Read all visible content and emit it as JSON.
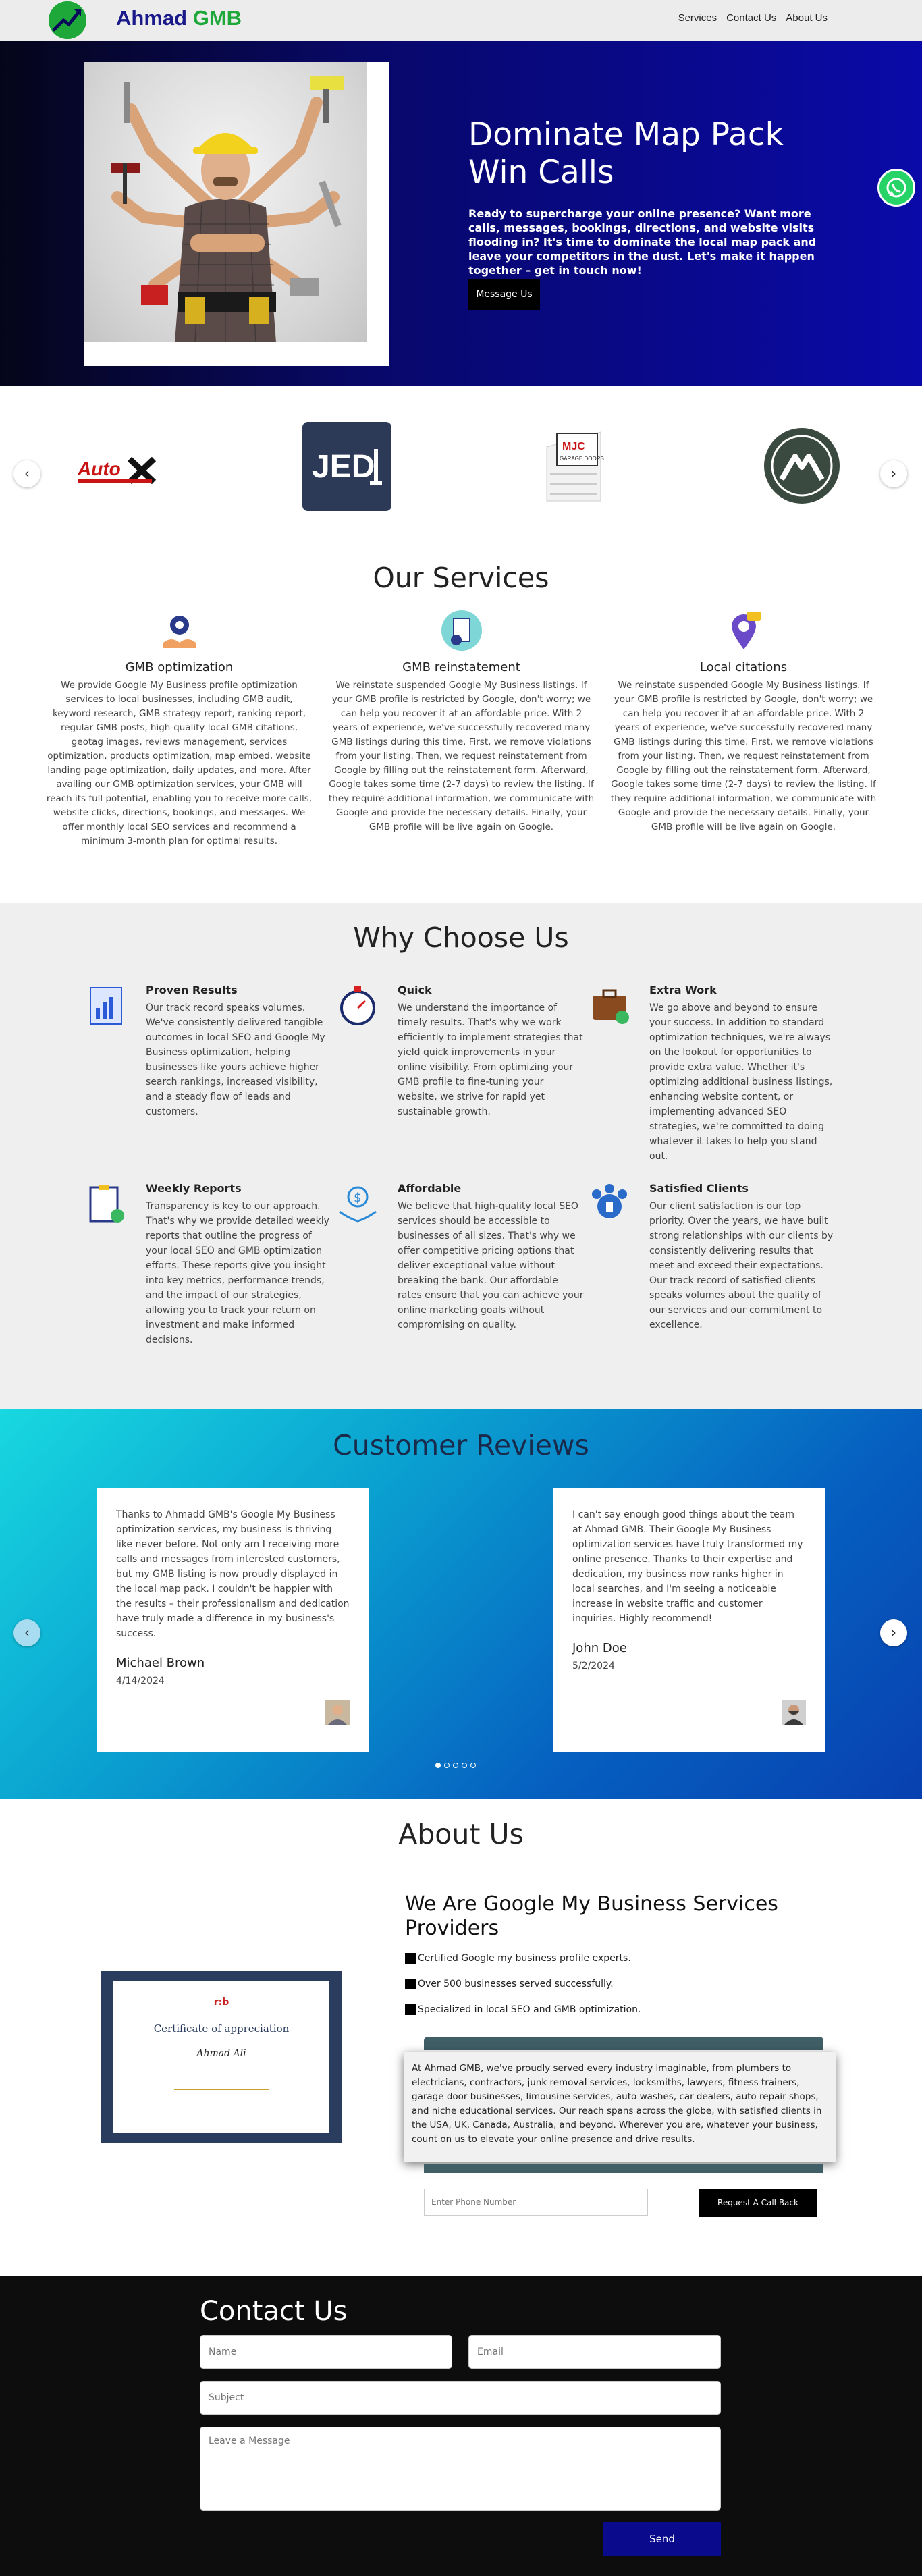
{
  "nav": {
    "brand_part1": "Ahmad",
    "brand_part2": "GMB",
    "links": [
      "Services",
      "Contact Us",
      "About Us"
    ]
  },
  "hero": {
    "title_line1": "Dominate Map Pack",
    "title_line2": "Win Calls",
    "text": "Ready to supercharge your online presence? Want more calls, messages, bookings, directions, and website visits flooding in? It's time to dominate the local map pack and leave your competitors in the dust. Let's make it happen together – get in touch now!",
    "button": "Message Us"
  },
  "logos": {
    "items": [
      "AutoX",
      "JED",
      "MJC Garage Doors",
      "Mountain logo"
    ]
  },
  "services": {
    "title": "Our Services",
    "items": [
      {
        "title": "GMB optimization",
        "text": "We provide Google My Business profile optimization services to local businesses, including GMB audit, keyword research, GMB strategy report, ranking report, regular GMB posts, high-quality local GMB citations, geotag images, reviews management, services optimization, products optimization, map embed, website landing page optimization, daily updates, and more. After availing our GMB optimization services, your GMB will reach its full potential, enabling you to receive more calls, website clicks, directions, bookings, and messages. We offer monthly local SEO services and recommend a minimum 3-month plan for optimal results."
      },
      {
        "title": "GMB reinstatement",
        "text": "We reinstate suspended Google My Business listings. If your GMB profile is restricted by Google, don't worry; we can help you recover it at an affordable price. With 2 years of experience, we've successfully recovered many GMB listings during this time. First, we remove violations from your listing. Then, we request reinstatement from Google by filling out the reinstatement form. Afterward, Google takes some time (2-7 days) to review the listing. If they require additional information, we communicate with Google and provide the necessary details. Finally, your GMB profile will be live again on Google."
      },
      {
        "title": "Local citations",
        "text": "We reinstate suspended Google My Business listings. If your GMB profile is restricted by Google, don't worry; we can help you recover it at an affordable price. With 2 years of experience, we've successfully recovered many GMB listings during this time. First, we remove violations from your listing. Then, we request reinstatement from Google by filling out the reinstatement form. Afterward, Google takes some time (2-7 days) to review the listing. If they require additional information, we communicate with Google and provide the necessary details. Finally, your GMB profile will be live again on Google."
      }
    ]
  },
  "why": {
    "title": "Why Choose Us",
    "items": [
      {
        "title": "Proven Results",
        "text": "Our track record speaks volumes. We've consistently delivered tangible outcomes in local SEO and Google My Business optimization, helping businesses like yours achieve higher search rankings, increased visibility, and a steady flow of leads and customers."
      },
      {
        "title": "Quick",
        "text": "We understand the importance of timely results. That's why we work efficiently to implement strategies that yield quick improvements in your online visibility. From optimizing your GMB profile to fine-tuning your website, we strive for rapid yet sustainable growth."
      },
      {
        "title": "Extra Work",
        "text": "We go above and beyond to ensure your success. In addition to standard optimization techniques, we're always on the lookout for opportunities to provide extra value. Whether it's optimizing additional business listings, enhancing website content, or implementing advanced SEO strategies, we're committed to doing whatever it takes to help you stand out."
      },
      {
        "title": "Weekly Reports",
        "text": "Transparency is key to our approach. That's why we provide detailed weekly reports that outline the progress of your local SEO and GMB optimization efforts. These reports give you insight into key metrics, performance trends, and the impact of our strategies, allowing you to track your return on investment and make informed decisions."
      },
      {
        "title": "Affordable",
        "text": "We believe that high-quality local SEO services should be accessible to businesses of all sizes. That's why we offer competitive pricing options that deliver exceptional value without breaking the bank. Our affordable rates ensure that you can achieve your online marketing goals without compromising on quality."
      },
      {
        "title": "Satisfied Clients",
        "text": "Our client satisfaction is our top priority. Over the years, we have built strong relationships with our clients by consistently delivering results that meet and exceed their expectations. Our track record of satisfied clients speaks volumes about the quality of our services and our commitment to excellence."
      }
    ]
  },
  "reviews": {
    "title": "Customer Reviews",
    "items": [
      {
        "text": "Thanks to Ahmadd GMB's Google My Business optimization services, my business is thriving like never before. Not only am I receiving more calls and messages from interested customers, but my GMB listing is now proudly displayed in the local map pack. I couldn't be happier with the results – their professionalism and dedication have truly made a difference in my business's success.",
        "name": "Michael Brown",
        "date": "4/14/2024"
      },
      {
        "text": "I can't say enough good things about the team at Ahmad GMB. Their Google My Business optimization services have truly transformed my online presence. Thanks to their expertise and dedication, my business now ranks higher in local searches, and I'm seeing a noticeable increase in website traffic and customer inquiries. Highly recommend!",
        "name": "John Doe",
        "date": "5/2/2024"
      }
    ],
    "dots_active": 0,
    "dots_count": 5
  },
  "about": {
    "title": "About Us",
    "heading": "We Are Google My Business Services Providers",
    "list": [
      "Certified Google my business profile experts.",
      "Over 500 businesses served successfully.",
      "Specialized in local SEO and GMB optimization."
    ],
    "box_text": "At Ahmad GMB, we've proudly served every industry imaginable, from plumbers to electricians, contractors, junk removal services, locksmiths, lawyers, fitness trainers, garage door businesses, limousine services, auto washes, car dealers, auto repair shops, and niche educational services. Our reach spans across the globe, with satisfied clients in the USA, UK, Canada, Australia, and beyond. Wherever you are, whatever your business, count on us to elevate your online presence and drive results.",
    "phone_placeholder": "Enter Phone Number",
    "callback_button": "Request A Call Back",
    "cert_logo": "r:b",
    "cert_title": "Certificate of appreciation",
    "cert_name": "Ahmad Ali"
  },
  "contact": {
    "title": "Contact Us",
    "name_placeholder": "Name",
    "email_placeholder": "Email",
    "subject_placeholder": "Subject",
    "message_placeholder": "Leave a Message",
    "send_button": "Send"
  },
  "colors": {
    "brand_blue": "#1a1a8a",
    "brand_green": "#1fa83a",
    "send_button": "#0a0a8c"
  }
}
